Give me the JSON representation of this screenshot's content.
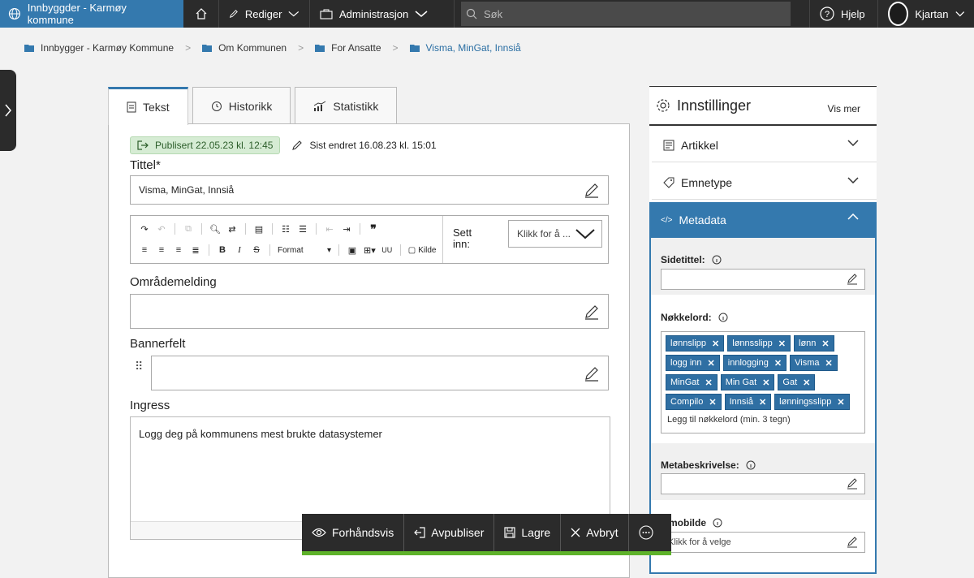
{
  "topbar": {
    "site_title": "Innbyggder - Karmøy kommune",
    "rediger": "Rediger",
    "administrasjon": "Administrasjon",
    "search_placeholder": "Søk",
    "help": "Hjelp",
    "user": "Kjartan"
  },
  "breadcrumb": [
    "Innbygger - Karmøy Kommune",
    "Om Kommunen",
    "For Ansatte",
    "Visma, MinGat, Innsiå"
  ],
  "tabs": [
    "Tekst",
    "Historikk",
    "Statistikk"
  ],
  "editor": {
    "published": "Publisert 22.05.23 kl. 12:45",
    "last_edited": "Sist endret 16.08.23 kl. 15:01",
    "title_label": "Tittel*",
    "title_value": "Visma, MinGat, Innsiå",
    "toolbar": {
      "format": "Format",
      "uu": "UU",
      "kilde": "Kilde",
      "insert_label": "Sett inn:",
      "insert_select": "Klikk for å ..."
    },
    "area_label": "Områdemelding",
    "banner_label": "Bannerfelt",
    "ingress_label": "Ingress",
    "ingress_text": "Logg deg på kommunens mest brukte datasystemer"
  },
  "settings": {
    "title": "Innstillinger",
    "vis_mer": "Vis mer",
    "sections": [
      "Artikkel",
      "Emnetype",
      "Metadata"
    ],
    "sidetittel_label": "Sidetittel:",
    "nokkelord_label": "Nøkkelord:",
    "keywords": [
      "lønnslipp",
      "lønnsslipp",
      "lønn",
      "logg inn",
      "innlogging",
      "Visma",
      "MinGat",
      "Min Gat",
      "Gat",
      "Compilo",
      "Innsiå",
      "lønningsslipp"
    ],
    "keyword_add": "Legg til nøkkelord (min. 3 tegn)",
    "metabeskrivelse_label": "Metabeskrivelse:",
    "image_label": "...mobilde",
    "image_placeholder": "Klikk for å velge"
  },
  "actions": [
    "Forhåndsvis",
    "Avpubliser",
    "Lagre",
    "Avbryt"
  ],
  "colors": {
    "accent": "#3479ae",
    "topbar": "#2b2b2b",
    "published_bg": "#d6ecd4",
    "save_bar": "#5eb22a"
  }
}
